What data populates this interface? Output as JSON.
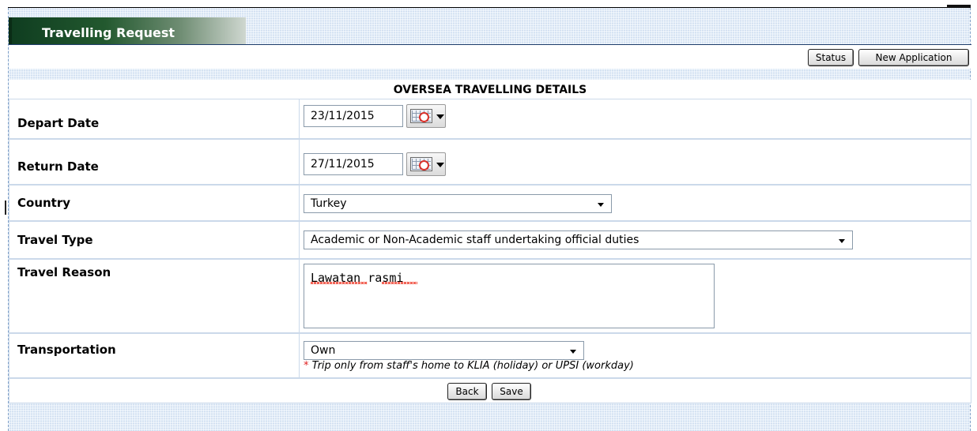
{
  "header": {
    "title": "Travelling Request"
  },
  "toolbar": {
    "status_label": "Status",
    "new_application_label": "New Application"
  },
  "section": {
    "title": "OVERSEA TRAVELLING DETAILS"
  },
  "form": {
    "depart_date": {
      "label": "Depart Date",
      "value": "23/11/2015",
      "icon": "calendar-icon"
    },
    "return_date": {
      "label": "Return Date",
      "value": "27/11/2015",
      "icon": "calendar-icon"
    },
    "country": {
      "label": "Country",
      "selected": "Turkey"
    },
    "travel_type": {
      "label": "Travel Type",
      "selected": "Academic or Non-Academic staff undertaking official duties"
    },
    "travel_reason": {
      "label": "Travel Reason",
      "value": "Lawatan rasmi"
    },
    "transportation": {
      "label": "Transportation",
      "selected": "Own",
      "note_marker": "*",
      "note": "Trip only from staff's home to KLIA (holiday) or UPSI (workday)"
    }
  },
  "actions": {
    "back_label": "Back",
    "save_label": "Save"
  },
  "colors": {
    "tab_dark": "#0f3d20",
    "panel_bg": "#e3edf8",
    "required_marker": "#e02020"
  }
}
